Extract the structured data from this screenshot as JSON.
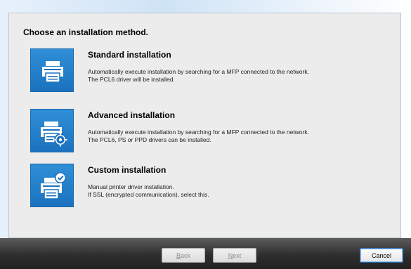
{
  "dialog": {
    "heading": "Choose an installation method."
  },
  "options": [
    {
      "title": "Standard installation",
      "desc_line1": "Automatically execute installation by searching for a MFP connected to the network.",
      "desc_line2": "The PCL6 driver will be installed.",
      "icon": "printer-icon"
    },
    {
      "title": "Advanced installation",
      "desc_line1": "Automatically execute installation by searching for a MFP connected to the network.",
      "desc_line2": "The PCL6, PS or PPD drivers can be installed.",
      "icon": "printer-gear-icon"
    },
    {
      "title": "Custom installation",
      "desc_line1": "Manual printer driver installation.",
      "desc_line2": "If SSL (encrypted communication), select this.",
      "icon": "printer-check-icon"
    }
  ],
  "footer": {
    "back_prefix": "",
    "back_mnemonic": "B",
    "back_rest": "ack",
    "next_prefix": "",
    "next_mnemonic": "N",
    "next_rest": "ext",
    "cancel_label": "Cancel"
  },
  "colors": {
    "tile": "#1b72bf",
    "footer": "#2e2e2e",
    "panel": "#ececec"
  }
}
